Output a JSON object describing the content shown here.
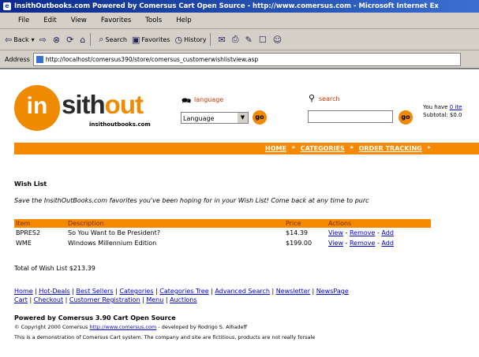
{
  "window": {
    "title": "InsithOutbooks.com Powered by Comersus Cart Open Source - http://www.comersus.com - Microsoft Internet Ex"
  },
  "menu": [
    "File",
    "Edit",
    "View",
    "Favorites",
    "Tools",
    "Help"
  ],
  "toolbar": {
    "back": "Back",
    "search": "Search",
    "favorites": "Favorites",
    "history": "History"
  },
  "address": {
    "label": "Address",
    "url": "http://localhost/comersus390/store/comersus_customerwishlistview.asp"
  },
  "header": {
    "logo_in": "in",
    "logo_sith": "sith",
    "logo_out": "out",
    "logo_sub": "insithoutbooks.com",
    "language_label": "language",
    "language_value": "Language",
    "search_label": "search",
    "go": "go",
    "cart_line1": "You have",
    "cart_link": "0 ite",
    "cart_line2": "Subtotal: $0.0"
  },
  "nav": {
    "home": "HOME",
    "categories": "CATEGORIES",
    "order_tracking": "ORDER TRACKING",
    "sep": "*"
  },
  "wishlist": {
    "title": "Wish List",
    "intro": "Save the InsithOutBooks.com favorites you've been hoping for in your Wish List! Come back at any time to purc",
    "columns": [
      "Item",
      "Description",
      "Price",
      "Actions"
    ],
    "rows": [
      {
        "item": "BPRES2",
        "description": "So You Want to Be President?",
        "price": "$14.39"
      },
      {
        "item": "WME",
        "description": "Windows Millennium Edition",
        "price": "$199.00"
      }
    ],
    "actions": {
      "view": "View",
      "remove": "Remove",
      "add": "Add",
      "dash": "-"
    },
    "total": "Total of Wish List $213.39"
  },
  "footer": {
    "links": [
      "Home",
      "Hot-Deals",
      "Best Sellers",
      "Categories",
      "Categories Tree",
      "Advanced Search",
      "Newsletter",
      "NewsPage",
      "Cart",
      "Checkout",
      "Customer Registration",
      "Menu",
      "Auctions"
    ],
    "powered": "Powered by Comersus 3.90 Cart Open Source",
    "copyright_pre": "© Copyright 2000 Comersus",
    "copyright_link": "http://www.comersus.com",
    "copyright_post": "- developed by Rodrigo S. Alhadeff",
    "demo": "This is a demonstration of Comersus Cart system. The company and site are fictitious, products are not really forsale"
  }
}
